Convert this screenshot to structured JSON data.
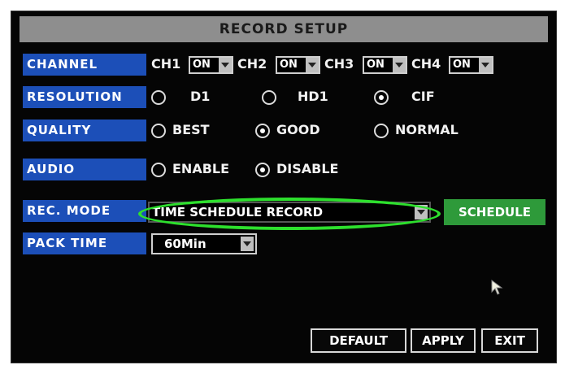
{
  "title": "RECORD SETUP",
  "channel": {
    "label": "CHANNEL",
    "items": [
      {
        "name": "CH1",
        "value": "ON"
      },
      {
        "name": "CH2",
        "value": "ON"
      },
      {
        "name": "CH3",
        "value": "ON"
      },
      {
        "name": "CH4",
        "value": "ON"
      }
    ]
  },
  "resolution": {
    "label": "RESOLUTION",
    "options": [
      "D1",
      "HD1",
      "CIF"
    ],
    "selected": "CIF"
  },
  "quality": {
    "label": "QUALITY",
    "options": [
      "BEST",
      "GOOD",
      "NORMAL"
    ],
    "selected": "GOOD"
  },
  "audio": {
    "label": "AUDIO",
    "options": [
      "ENABLE",
      "DISABLE"
    ],
    "selected": "DISABLE"
  },
  "rec_mode": {
    "label": "REC. MODE",
    "value": "TIME SCHEDULE RECORD",
    "schedule_button": "SCHEDULE"
  },
  "pack_time": {
    "label": "PACK TIME",
    "value": "60Min"
  },
  "buttons": {
    "default": "DEFAULT",
    "apply": "APPLY",
    "exit": "EXIT"
  },
  "colors": {
    "label_bg": "#1c4fb8",
    "title_bg": "#8e8e8e",
    "schedule_bg": "#2e9a3a",
    "highlight": "#2de02d",
    "screen_bg": "#050505"
  },
  "icons": {
    "cursor": "mouse-pointer-icon",
    "dropdown": "dropdown-arrow-icon"
  }
}
